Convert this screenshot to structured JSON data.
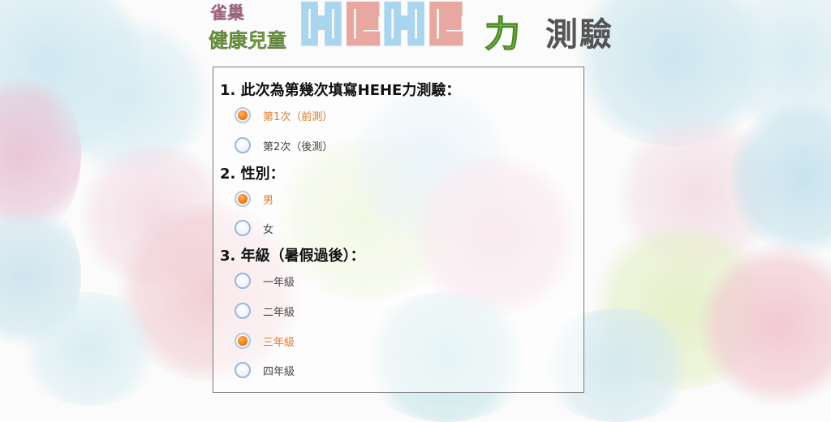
{
  "header": {
    "logo_line1": "雀巢",
    "logo_line2": "健康兒童",
    "logo_hehe": [
      "H",
      "E",
      "H",
      "E"
    ],
    "logo_power": "力",
    "logo_test": "測驗",
    "colors": {
      "h1": "#a9d6ee",
      "e1": "#e8a7a0",
      "h2": "#a9d6ee",
      "e2": "#e8a7a0",
      "power": "#7cc04a"
    }
  },
  "questions": [
    {
      "title": "1. 此次為第幾次填寫HEHE力測驗：",
      "options": [
        {
          "label": "第1次（前測）",
          "selected": true
        },
        {
          "label": "第2次（後測）",
          "selected": false
        }
      ]
    },
    {
      "title": "2. 性別：",
      "options": [
        {
          "label": "男",
          "selected": true
        },
        {
          "label": "女",
          "selected": false
        }
      ]
    },
    {
      "title": "3. 年級（暑假過後）：",
      "options": [
        {
          "label": "一年級",
          "selected": false
        },
        {
          "label": "二年級",
          "selected": false
        },
        {
          "label": "三年級",
          "selected": true
        },
        {
          "label": "四年級",
          "selected": false
        }
      ]
    }
  ],
  "colors": {
    "selected_text": "#e07b2a",
    "radio_fill": "#f07a12",
    "border": "#7a7a7a"
  }
}
